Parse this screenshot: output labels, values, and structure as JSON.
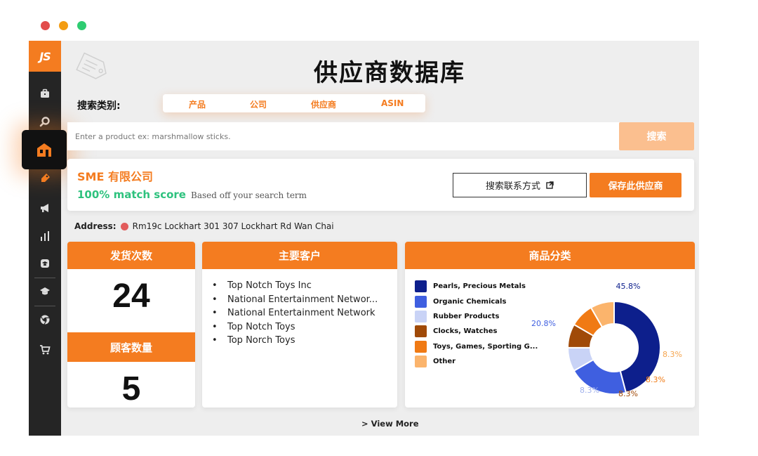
{
  "window": {
    "dot_colors": [
      "#e24c4b",
      "#f39c12",
      "#2ecc71"
    ]
  },
  "sidebar": {
    "logo": "JS",
    "items": [
      {
        "icon": "briefcase-icon"
      },
      {
        "icon": "search-icon"
      },
      {
        "icon": "supplier-database-icon",
        "active": true
      },
      {
        "icon": "keyword-icon"
      },
      {
        "icon": "megaphone-icon"
      },
      {
        "icon": "bar-chart-icon"
      },
      {
        "icon": "academy-icon"
      },
      {
        "icon": "graduation-cap-icon"
      },
      {
        "icon": "chrome-icon"
      },
      {
        "icon": "cart-icon"
      }
    ]
  },
  "page": {
    "title": "供应商数据库"
  },
  "category": {
    "label": "搜索类别:",
    "tabs": [
      "产品",
      "公司",
      "供应商",
      "ASIN"
    ]
  },
  "search": {
    "placeholder": "Enter a product ex: marshmallow sticks.",
    "button": "搜索"
  },
  "company": {
    "name": "SME 有限公司",
    "match": "100% match score",
    "match_note": "Based off your search term",
    "contact_button": "搜索联系方式",
    "save_button": "保存此供应商"
  },
  "address": {
    "label": "Address:",
    "value": "Rm19c Lockhart 301 307 Lockhart Rd Wan Chai"
  },
  "shipments": {
    "title": "发货次数",
    "value": "24"
  },
  "customer_count": {
    "title": "顾客数量",
    "value": "5"
  },
  "top_customers": {
    "title": "主要客户",
    "items": [
      "Top Notch Toys Inc",
      "National Entertainment Networ...",
      "National Entertainment Network",
      "Top Notch Toys",
      "Top Norch Toys"
    ]
  },
  "categories_card": {
    "title": "商品分类"
  },
  "chart_data": {
    "type": "pie",
    "donut": true,
    "legend_position": "left",
    "slices": [
      {
        "name": "Pearls, Precious Metals",
        "value": 45.8,
        "label": "45.8%",
        "color": "#0d1f8c"
      },
      {
        "name": "Organic Chemicals",
        "value": 20.8,
        "label": "20.8%",
        "color": "#3f5fe0"
      },
      {
        "name": "Rubber Products",
        "value": 8.3,
        "label": "8.3%",
        "color": "#c9d3f6"
      },
      {
        "name": "Clocks, Watches",
        "value": 8.3,
        "label": "8.3%",
        "color": "#a04a08"
      },
      {
        "name": "Toys, Games, Sporting G...",
        "value": 8.3,
        "label": "8.3%",
        "color": "#f07a14"
      },
      {
        "name": "Other",
        "value": 8.3,
        "label": "8.3%",
        "color": "#fbb46c"
      }
    ]
  },
  "footer": {
    "view_more": "> View More"
  }
}
